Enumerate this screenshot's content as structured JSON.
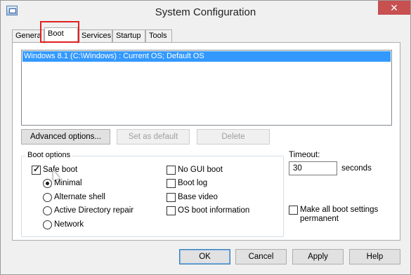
{
  "window": {
    "title": "System Configuration",
    "close_glyph": "✕"
  },
  "tabs": [
    {
      "label": "Genera"
    },
    {
      "label": "Boot"
    },
    {
      "label": "Services"
    },
    {
      "label": "Startup"
    },
    {
      "label": "Tools"
    }
  ],
  "boot": {
    "os_entries": [
      "Windows 8.1 (C:\\Windows) : Current OS; Default OS"
    ],
    "buttons": {
      "advanced": "Advanced options...",
      "set_default": "Set as default",
      "delete": "Delete"
    },
    "boot_options_label": "Boot options",
    "safe_boot": {
      "label": "Safe boot",
      "checked": true
    },
    "safe_boot_modes": [
      {
        "label": "Minimal",
        "selected": true
      },
      {
        "label": "Alternate shell",
        "selected": false
      },
      {
        "label": "Active Directory repair",
        "selected": false
      },
      {
        "label": "Network",
        "selected": false
      }
    ],
    "right_options": [
      {
        "label": "No GUI boot",
        "checked": false
      },
      {
        "label": "Boot log",
        "checked": false
      },
      {
        "label": "Base video",
        "checked": false
      },
      {
        "label": "OS boot information",
        "checked": false
      }
    ],
    "timeout": {
      "label": "Timeout:",
      "value": "30",
      "unit": "seconds"
    },
    "make_permanent": {
      "label_line1": "Make all boot settings",
      "label_line2": "permanent",
      "checked": false
    }
  },
  "dialog_buttons": {
    "ok": "OK",
    "cancel": "Cancel",
    "apply": "Apply",
    "help": "Help"
  },
  "colors": {
    "selection": "#3399ff",
    "highlight_box": "#e02020",
    "close_button": "#c75050"
  }
}
